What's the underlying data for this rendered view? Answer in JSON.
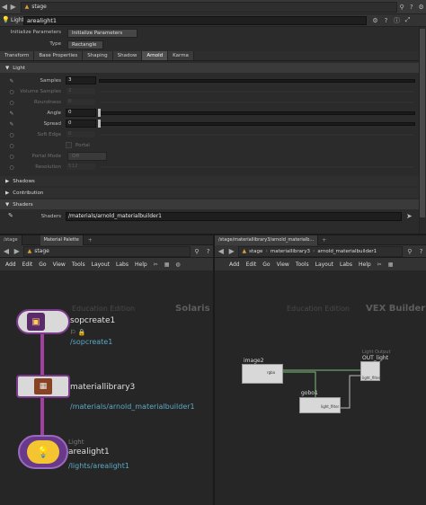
{
  "top": {
    "path": "stage",
    "node_type": "Light",
    "node_name": "arealight1"
  },
  "params": {
    "init_label": "Initialize Parameters",
    "init_value": "Initialize Parameters",
    "type_label": "Type",
    "type_value": "Rectangle"
  },
  "tabs": [
    "Transform",
    "Base Properties",
    "Shaping",
    "Shadow",
    "Arnold",
    "Karma"
  ],
  "active_tab": "Arnold",
  "light_section": "Light",
  "light_rows": [
    {
      "label": "Samples",
      "value": "3",
      "state": "active"
    },
    {
      "label": "Volume Samples",
      "value": "2",
      "state": "dim"
    },
    {
      "label": "Roundness",
      "value": "0",
      "state": "dim"
    },
    {
      "label": "Angle",
      "value": "0",
      "state": "active"
    },
    {
      "label": "Spread",
      "value": "0",
      "state": "active"
    },
    {
      "label": "Soft Edge",
      "value": "0",
      "state": "dim"
    },
    {
      "label": "Portal",
      "value": "",
      "state": "dim"
    },
    {
      "label": "Portal Mode",
      "value": "Off",
      "state": "dim"
    },
    {
      "label": "Resolution",
      "value": "512",
      "state": "dim"
    }
  ],
  "sections": [
    "Shadows",
    "Contribution",
    "Shaders"
  ],
  "shaders": {
    "label": "Shaders",
    "value": "/materials/arnold_materialbuilder1"
  },
  "left_pane": {
    "tabs": [
      "/stage",
      "Material Palette"
    ],
    "path": "stage",
    "menus": [
      "Add",
      "Edit",
      "Go",
      "View",
      "Tools",
      "Layout",
      "Labs",
      "Help"
    ],
    "watermark": "Education Edition",
    "context": "Solaris",
    "nodes": [
      {
        "name": "sopcreate1",
        "path": "/sopcreate1"
      },
      {
        "name": "materiallibrary3",
        "path": "/materials/arnold_materialbuilder1"
      },
      {
        "type": "Light",
        "name": "arealight1",
        "path": "/lights/arealight1"
      }
    ]
  },
  "right_pane": {
    "tabs": [
      "/stage/materiallibrary3/arnold_materialb..."
    ],
    "crumbs": [
      "stage",
      "materiallibrary3",
      "arnold_materialbuilder1"
    ],
    "menus": [
      "Add",
      "Edit",
      "Go",
      "View",
      "Tools",
      "Layout",
      "Labs",
      "Help"
    ],
    "watermark": "Education Edition",
    "context": "VEX Builder",
    "nodes": [
      {
        "name": "image2",
        "port": "rgba"
      },
      {
        "name": "gobo1",
        "port": "light_filter"
      },
      {
        "type": "Light Output",
        "name": "OUT_light",
        "port": "light_filters"
      }
    ]
  }
}
